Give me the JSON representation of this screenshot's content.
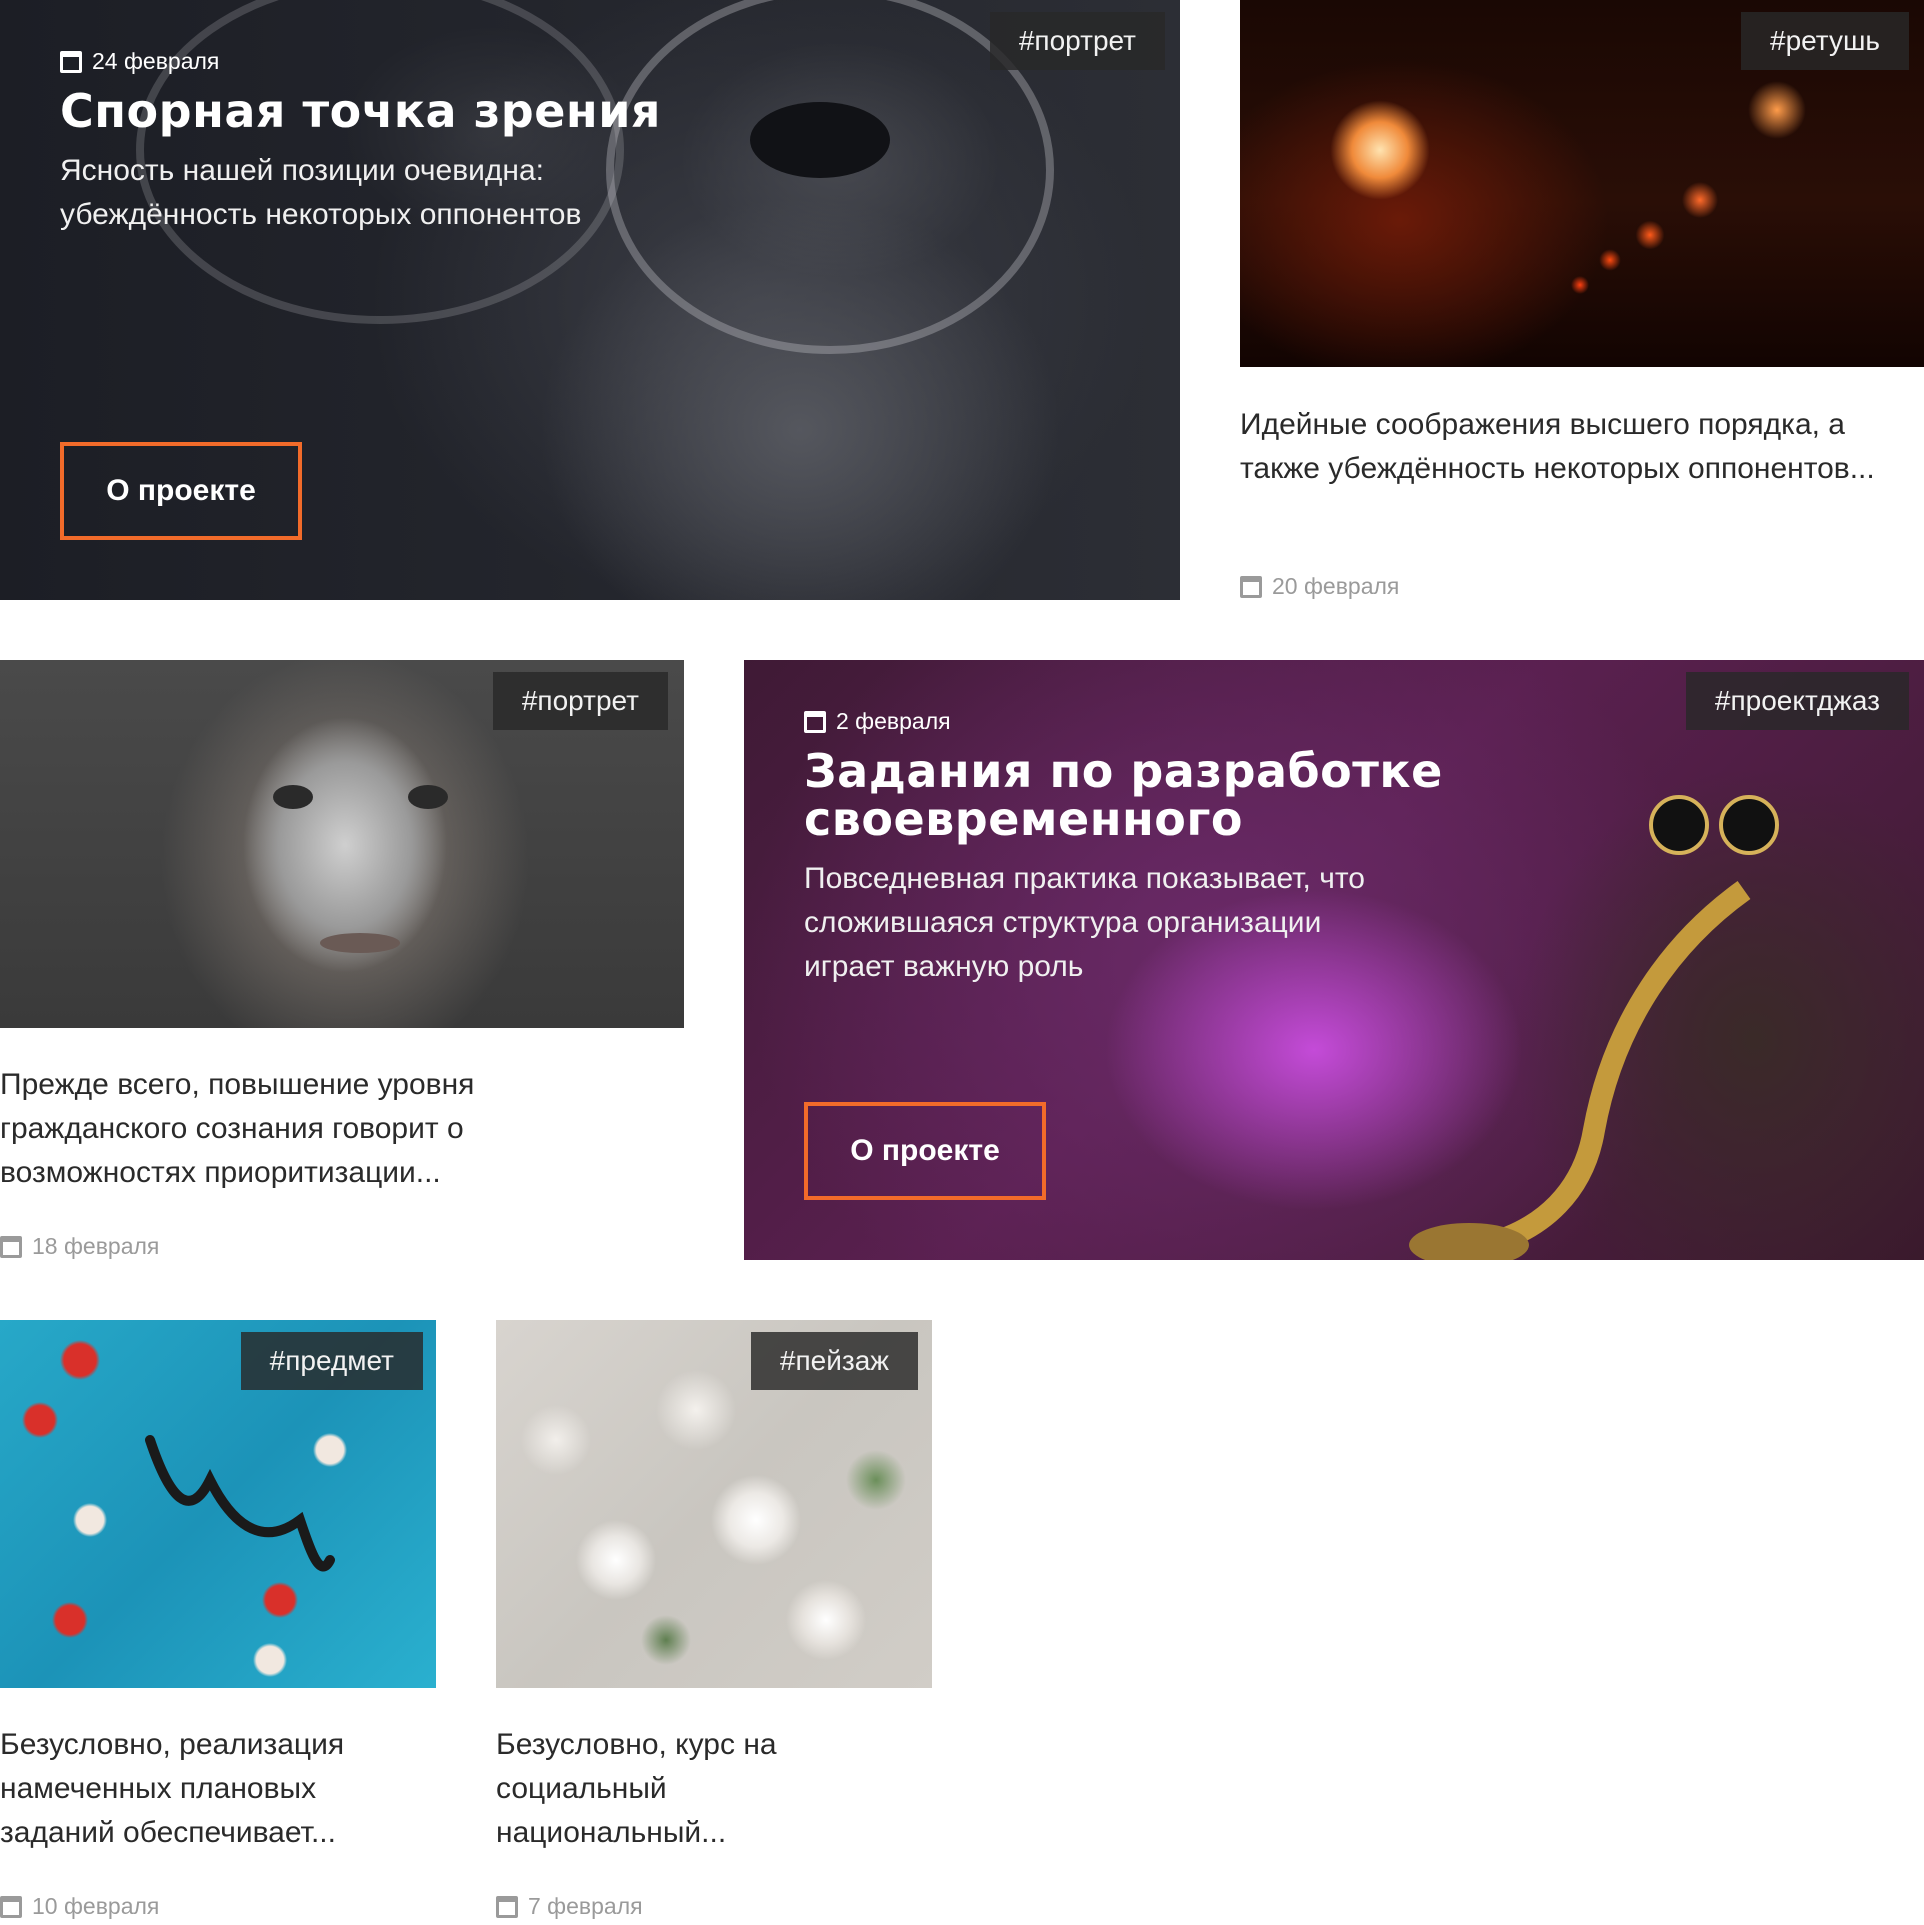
{
  "cards": [
    {
      "tag": "#портрет",
      "date": "24 февраля",
      "title": "Спорная точка зрения",
      "lead": "Ясность нашей позиции очевидна: убеждённость некоторых оппонентов",
      "button": "О проекте"
    },
    {
      "tag": "#ретушь",
      "excerpt": "Идейные соображения высшего порядка, а также убеждённость некоторых оппонентов...",
      "date": "20 февраля"
    },
    {
      "tag": "#портрет",
      "excerpt": "Прежде всего, повышение уровня гражданского сознания говорит о возможностях приоритизации...",
      "date": "18 февраля"
    },
    {
      "tag": "#проектджаз",
      "date": "2 февраля",
      "title": "Задания по разработке своевременного",
      "lead": "Повседневная практика показывает, что сложившаяся структура организации играет важную роль",
      "button": "О проекте"
    },
    {
      "tag": "#предмет",
      "excerpt": "Безусловно, реализация намеченных плановых заданий обеспечивает...",
      "date": "10 февраля"
    },
    {
      "tag": "#пейзаж",
      "excerpt": "Безусловно, курс на социальный национальный...",
      "date": "7 февраля"
    }
  ],
  "colors": {
    "accent": "#f26b2a",
    "tag_bg": "#2b2b2b",
    "meta_text": "#9a9a9a"
  },
  "icons": {
    "date": "calendar-icon"
  }
}
